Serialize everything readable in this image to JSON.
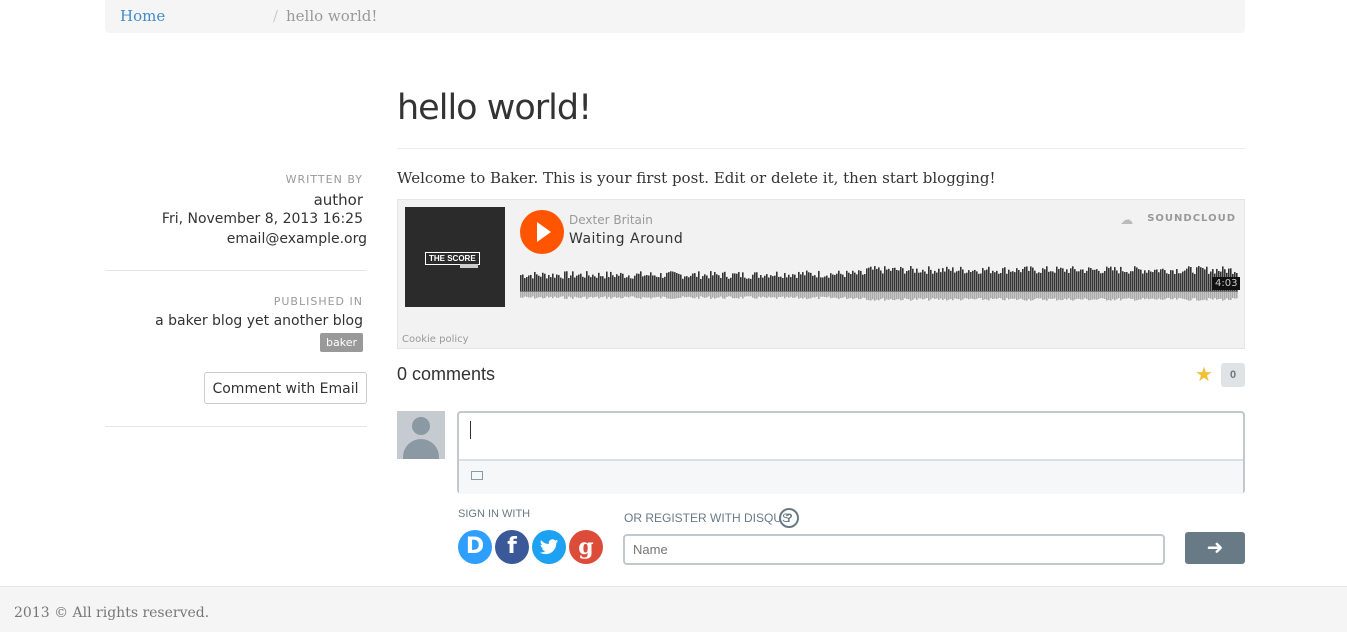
{
  "breadcrumb": {
    "home": "Home",
    "separator": "/",
    "current": "hello world!"
  },
  "sidebar": {
    "written_by_label": "WRITTEN BY",
    "author": "author",
    "date": "Fri, November 8, 2013 16:25",
    "email": "email@example.org",
    "published_in_label": "PUBLISHED IN",
    "blog": "a baker blog yet another blog",
    "tag": "baker",
    "comment_button": "Comment with Email"
  },
  "post": {
    "title": "hello world!",
    "body": "Welcome to Baker. This is your first post. Edit or delete it, then start blogging!"
  },
  "soundcloud": {
    "artwork_label": "THE SCORE",
    "artist": "Dexter Britain",
    "track": "Waiting Around",
    "brand": "SOUNDCLOUD",
    "duration": "4:03",
    "cookie_policy": "Cookie policy",
    "icons": {
      "play": "play-icon",
      "brand": "soundcloud-icon"
    },
    "colors": {
      "play": "#ff5500"
    }
  },
  "comments": {
    "count_label": "0 comments",
    "star_count": "0",
    "sign_in_label": "SIGN IN WITH",
    "register_label": "OR REGISTER WITH DISQUS",
    "help": "?",
    "name_placeholder": "Name",
    "social": {
      "disqus": "D",
      "facebook": "f",
      "google": "g"
    },
    "icons": {
      "star": "star-icon",
      "image": "image-icon",
      "arrow": "arrow-right-icon"
    }
  },
  "footer": {
    "text": "2013 © All rights reserved."
  }
}
